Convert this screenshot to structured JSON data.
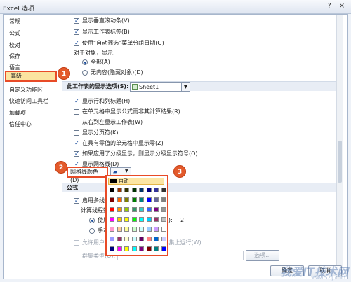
{
  "window": {
    "title": "Excel 选项",
    "help": "?",
    "close": "×"
  },
  "sidebar": {
    "items": [
      {
        "label": "常规"
      },
      {
        "label": "公式"
      },
      {
        "label": "校对"
      },
      {
        "label": "保存"
      },
      {
        "label": "语言"
      },
      {
        "label": "高级",
        "selected": true
      },
      {
        "label": "自定义功能区"
      },
      {
        "label": "快速访问工具栏"
      },
      {
        "label": "加载项"
      },
      {
        "label": "信任中心"
      }
    ]
  },
  "options_top": [
    {
      "label": "显示垂直滚动条(V)",
      "checked": true
    },
    {
      "label": "显示工作表标签(B)",
      "checked": true
    },
    {
      "label": "使用“自动筛选”菜单分组日期(G)",
      "checked": true
    }
  ],
  "objects": {
    "label": "对于对象，显示:",
    "options": [
      {
        "label": "全部(A)",
        "selected": true
      },
      {
        "label": "无内容(隐藏对象)(D)",
        "selected": false
      }
    ]
  },
  "sheet_section": {
    "label": "此工作表的显示选项(S):",
    "sheet": "Sheet1"
  },
  "sheet_options": [
    {
      "label": "显示行和列标题(H)",
      "checked": true
    },
    {
      "label": "在单元格中显示公式而非其计算结果(R)",
      "checked": false
    },
    {
      "label": "从右到左显示工作表(W)",
      "checked": false
    },
    {
      "label": "显示分页符(K)",
      "checked": false
    },
    {
      "label": "在具有零值的单元格中显示零(Z)",
      "checked": true
    },
    {
      "label": "如果应用了分级显示，则显示分级显示符号(O)",
      "checked": true
    },
    {
      "label": "显示网格线(D)",
      "checked": true
    }
  ],
  "gridline": {
    "label": "网格线颜色(D)",
    "auto_label": "自动"
  },
  "formulas": {
    "title": "公式",
    "multithread": "启用多线程计",
    "threads": "计算线程数",
    "use_prefix": "使用",
    "manual_prefix": "手动",
    "threads_suffix": "P):",
    "threads_value": "2",
    "xll": "允许用户定义的 XLL 函数在计算群集上运行(W)",
    "cluster": "群集类型(O):",
    "options_btn": "选项..."
  },
  "footer": {
    "ok": "确定",
    "cancel": "取消"
  },
  "badges": [
    "1",
    "2",
    "3"
  ],
  "watermark": {
    "text": "我爱IT技术网",
    "url": "www.52ij.com"
  },
  "palette_colors": [
    "#000000",
    "#993300",
    "#333300",
    "#003300",
    "#003366",
    "#000080",
    "#333399",
    "#333333",
    "#800000",
    "#ff6600",
    "#808000",
    "#008000",
    "#008080",
    "#0000ff",
    "#666699",
    "#808080",
    "#ff0000",
    "#ff9900",
    "#99cc00",
    "#339966",
    "#33cccc",
    "#3366ff",
    "#800080",
    "#969696",
    "#ff00ff",
    "#ffcc00",
    "#ffff00",
    "#00ff00",
    "#00ffff",
    "#00ccff",
    "#993366",
    "#c0c0c0",
    "#ff99cc",
    "#ffcc99",
    "#ffff99",
    "#ccffcc",
    "#ccffff",
    "#99ccff",
    "#cc99ff",
    "#ffffff",
    "#9999ff",
    "#993366",
    "#ffffcc",
    "#ccffff",
    "#660066",
    "#ff8080",
    "#0066cc",
    "#ccccff",
    "#000080",
    "#ff00ff",
    "#ffff00",
    "#00ffff",
    "#800080",
    "#800000",
    "#008080",
    "#0000ff"
  ],
  "colors": {
    "accent": "#e84b27",
    "selected_bg": "#fbe4a0",
    "badge": "#e35a2b"
  }
}
